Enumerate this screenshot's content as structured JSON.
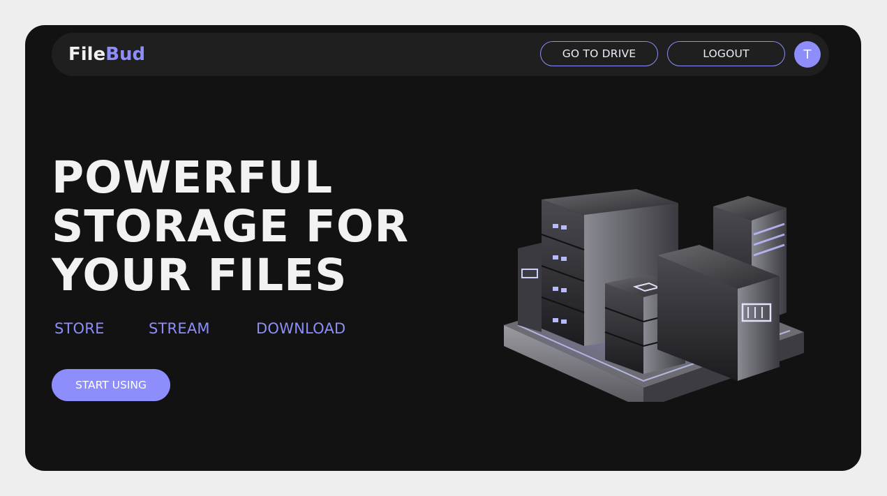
{
  "header": {
    "logo_part1": "File",
    "logo_part2": "Bud",
    "go_to_drive_label": "GO TO DRIVE",
    "logout_label": "LOGOUT",
    "avatar_initial": "T"
  },
  "hero": {
    "title_lines": [
      "POWERFUL",
      "STORAGE FOR",
      "YOUR FILES"
    ],
    "features": [
      "STORE",
      "STREAM",
      "DOWNLOAD"
    ],
    "cta_label": "START USING"
  },
  "colors": {
    "accent": "#8d8dfb",
    "background": "#121212",
    "navbar": "#1f1f1f",
    "page": "#eeeeee"
  },
  "icons": {
    "illustration": "server-stack-illustration"
  }
}
